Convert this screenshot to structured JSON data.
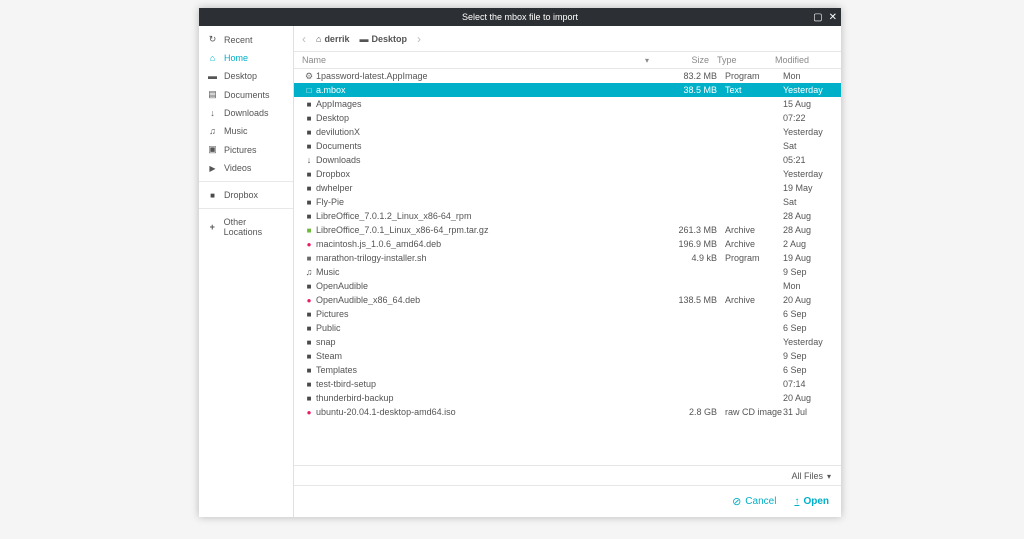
{
  "window": {
    "title": "Select the mbox file to import"
  },
  "sidebar": {
    "items": [
      {
        "name": "recent",
        "label": "Recent",
        "icon": "ic-recent"
      },
      {
        "name": "home",
        "label": "Home",
        "icon": "ic-home",
        "active": true
      },
      {
        "name": "desktop",
        "label": "Desktop",
        "icon": "ic-desk"
      },
      {
        "name": "documents",
        "label": "Documents",
        "icon": "ic-doc"
      },
      {
        "name": "downloads",
        "label": "Downloads",
        "icon": "ic-down"
      },
      {
        "name": "music",
        "label": "Music",
        "icon": "ic-music"
      },
      {
        "name": "pictures",
        "label": "Pictures",
        "icon": "ic-pic"
      },
      {
        "name": "videos",
        "label": "Videos",
        "icon": "ic-vid"
      }
    ],
    "extra": [
      {
        "name": "dropbox",
        "label": "Dropbox",
        "icon": "ic-folder"
      }
    ],
    "other": {
      "label": "Other Locations",
      "icon": "ic-plus"
    }
  },
  "path": {
    "crumbs": [
      {
        "label": "derrik",
        "icon": "ic-home"
      },
      {
        "label": "Desktop",
        "icon": "ic-desk"
      }
    ]
  },
  "columns": {
    "name": "Name",
    "size": "Size",
    "type": "Type",
    "modified": "Modified"
  },
  "files": [
    {
      "icon": "ic-gear",
      "name": "1password-latest.AppImage",
      "size": "83.2 MB",
      "type": "Program",
      "mod": "Mon"
    },
    {
      "icon": "ic-file-w",
      "name": "a.mbox",
      "size": "38.5 MB",
      "type": "Text",
      "mod": "Yesterday",
      "selected": true
    },
    {
      "icon": "ic-folder",
      "name": "AppImages",
      "size": "",
      "type": "",
      "mod": "15 Aug"
    },
    {
      "icon": "ic-folder",
      "name": "Desktop",
      "size": "",
      "type": "",
      "mod": "07:22"
    },
    {
      "icon": "ic-folder",
      "name": "devilutionX",
      "size": "",
      "type": "",
      "mod": "Yesterday"
    },
    {
      "icon": "ic-folder",
      "name": "Documents",
      "size": "",
      "type": "",
      "mod": "Sat"
    },
    {
      "icon": "ic-down",
      "name": "Downloads",
      "size": "",
      "type": "",
      "mod": "05:21"
    },
    {
      "icon": "ic-folder",
      "name": "Dropbox",
      "size": "",
      "type": "",
      "mod": "Yesterday"
    },
    {
      "icon": "ic-folder",
      "name": "dwhelper",
      "size": "",
      "type": "",
      "mod": "19 May"
    },
    {
      "icon": "ic-folder",
      "name": "Fly-Pie",
      "size": "",
      "type": "",
      "mod": "Sat"
    },
    {
      "icon": "ic-folder",
      "name": "LibreOffice_7.0.1.2_Linux_x86-64_rpm",
      "size": "",
      "type": "",
      "mod": "28 Aug"
    },
    {
      "icon": "ic-arch",
      "name": "LibreOffice_7.0.1_Linux_x86-64_rpm.tar.gz",
      "size": "261.3 MB",
      "type": "Archive",
      "mod": "28 Aug"
    },
    {
      "icon": "ic-deb",
      "name": "macintosh.js_1.0.6_amd64.deb",
      "size": "196.9 MB",
      "type": "Archive",
      "mod": "2 Aug"
    },
    {
      "icon": "ic-file",
      "name": "marathon-trilogy-installer.sh",
      "size": "4.9 kB",
      "type": "Program",
      "mod": "19 Aug"
    },
    {
      "icon": "ic-music",
      "name": "Music",
      "size": "",
      "type": "",
      "mod": "9 Sep"
    },
    {
      "icon": "ic-folder",
      "name": "OpenAudible",
      "size": "",
      "type": "",
      "mod": "Mon"
    },
    {
      "icon": "ic-deb",
      "name": "OpenAudible_x86_64.deb",
      "size": "138.5 MB",
      "type": "Archive",
      "mod": "20 Aug"
    },
    {
      "icon": "ic-folder",
      "name": "Pictures",
      "size": "",
      "type": "",
      "mod": "6 Sep"
    },
    {
      "icon": "ic-folder",
      "name": "Public",
      "size": "",
      "type": "",
      "mod": "6 Sep"
    },
    {
      "icon": "ic-folder",
      "name": "snap",
      "size": "",
      "type": "",
      "mod": "Yesterday"
    },
    {
      "icon": "ic-folder",
      "name": "Steam",
      "size": "",
      "type": "",
      "mod": "9 Sep"
    },
    {
      "icon": "ic-folder",
      "name": "Templates",
      "size": "",
      "type": "",
      "mod": "6 Sep"
    },
    {
      "icon": "ic-folder",
      "name": "test-tbird-setup",
      "size": "",
      "type": "",
      "mod": "07:14"
    },
    {
      "icon": "ic-folder",
      "name": "thunderbird-backup",
      "size": "",
      "type": "",
      "mod": "20 Aug"
    },
    {
      "icon": "ic-deb",
      "name": "ubuntu-20.04.1-desktop-amd64.iso",
      "size": "2.8 GB",
      "type": "raw CD image",
      "mod": "31 Jul"
    }
  ],
  "filter": {
    "label": "All Files"
  },
  "actions": {
    "cancel": "Cancel",
    "open": "Open"
  }
}
